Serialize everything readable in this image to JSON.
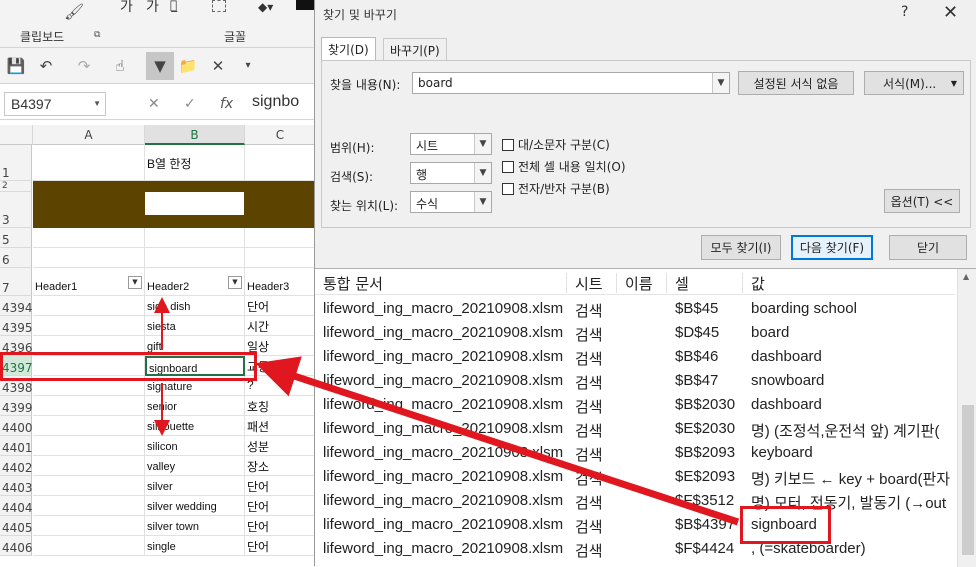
{
  "ribbon": {
    "clipboard_label": "클립보드",
    "font_label": "글꼴",
    "font_sample_a": "가",
    "font_sample_b": "가"
  },
  "formula_bar": {
    "name_box": "B4397",
    "fx": "fx",
    "content": "signbo"
  },
  "sheet": {
    "col_headers": [
      "A",
      "B",
      "C"
    ],
    "selected_col": "B",
    "row1": {
      "row": "1",
      "b": "B열 한정"
    },
    "rows_top": [
      "2",
      "3",
      "5",
      "6"
    ],
    "header_row": {
      "row": "7",
      "a": "Header1",
      "b": "Header2",
      "c": "Header3"
    },
    "data_rows": [
      {
        "row": "4394",
        "b": "side dish",
        "c": "단어"
      },
      {
        "row": "4395",
        "b": "siesta",
        "c": "시간"
      },
      {
        "row": "4396",
        "b": "gift",
        "c": "일상"
      },
      {
        "row": "4397",
        "b": "signboard",
        "c": "교통"
      },
      {
        "row": "4398",
        "b": "signature",
        "c": "?"
      },
      {
        "row": "4399",
        "b": "senior",
        "c": "호칭"
      },
      {
        "row": "4400",
        "b": "silhouette",
        "c": "패션"
      },
      {
        "row": "4401",
        "b": "silicon",
        "c": "성분"
      },
      {
        "row": "4402",
        "b": "valley",
        "c": "장소"
      },
      {
        "row": "4403",
        "b": "silver",
        "c": "단어"
      },
      {
        "row": "4404",
        "b": "silver wedding",
        "c": "단어"
      },
      {
        "row": "4405",
        "b": "silver town",
        "c": "단어"
      },
      {
        "row": "4406",
        "b": "single",
        "c": "단어"
      }
    ],
    "band_color": "#5c4400"
  },
  "dialog": {
    "title": "찾기 및 바꾸기",
    "help": "?",
    "close": "✕",
    "tabs": [
      "찾기(D)",
      "바꾸기(P)"
    ],
    "find_label": "찾을 내용(N):",
    "find_value": "board",
    "no_format_button": "설정된 서식 없음",
    "format_button": "서식(M)...",
    "scope_label": "범위(H):",
    "scope_value": "시트",
    "search_label": "검색(S):",
    "search_value": "행",
    "lookin_label": "찾는 위치(L):",
    "lookin_value": "수식",
    "match_case": "대/소문자 구분(C)",
    "match_entire": "전체 셀 내용 일치(O)",
    "match_byte": "전자/반자 구분(B)",
    "options_button": "옵션(T) <<",
    "find_all_button": "모두 찾기(I)",
    "find_next_button": "다음 찾기(F)",
    "close_button": "닫기"
  },
  "results": {
    "columns": [
      "통합 문서",
      "시트",
      "이름",
      "셀",
      "값"
    ],
    "rows": [
      {
        "book": "lifeword_ing_macro_20210908.xlsm",
        "sheet": "검색",
        "name": "",
        "cell": "$B$45",
        "value": "boarding school"
      },
      {
        "book": "lifeword_ing_macro_20210908.xlsm",
        "sheet": "검색",
        "name": "",
        "cell": "$D$45",
        "value": "board"
      },
      {
        "book": "lifeword_ing_macro_20210908.xlsm",
        "sheet": "검색",
        "name": "",
        "cell": "$B$46",
        "value": "dashboard"
      },
      {
        "book": "lifeword_ing_macro_20210908.xlsm",
        "sheet": "검색",
        "name": "",
        "cell": "$B$47",
        "value": "snowboard"
      },
      {
        "book": "lifeword_ing_macro_20210908.xlsm",
        "sheet": "검색",
        "name": "",
        "cell": "$B$2030",
        "value": "dashboard"
      },
      {
        "book": "lifeword_ing_macro_20210908.xlsm",
        "sheet": "검색",
        "name": "",
        "cell": "$E$2030",
        "value": "명) (조정석,운전석 앞) 계기판("
      },
      {
        "book": "lifeword_ing_macro_20210908.xlsm",
        "sheet": "검색",
        "name": "",
        "cell": "$B$2093",
        "value": "keyboard"
      },
      {
        "book": "lifeword_ing_macro_20210908.xlsm",
        "sheet": "검색",
        "name": "",
        "cell": "$E$2093",
        "value": "명) 키보드 ← key + board(판자"
      },
      {
        "book": "lifeword_ing_macro_20210908.xlsm",
        "sheet": "검색",
        "name": "",
        "cell": "$F$3512",
        "value": "명) 모터, 전동기, 발동기 (→out"
      },
      {
        "book": "lifeword_ing_macro_20210908.xlsm",
        "sheet": "검색",
        "name": "",
        "cell": "$B$4397",
        "value": "signboard"
      },
      {
        "book": "lifeword_ing_macro_20210908.xlsm",
        "sheet": "검색",
        "name": "",
        "cell": "$F$4424",
        "value": ", (=skateboarder)"
      }
    ]
  },
  "annotation_color": "#e0171f"
}
